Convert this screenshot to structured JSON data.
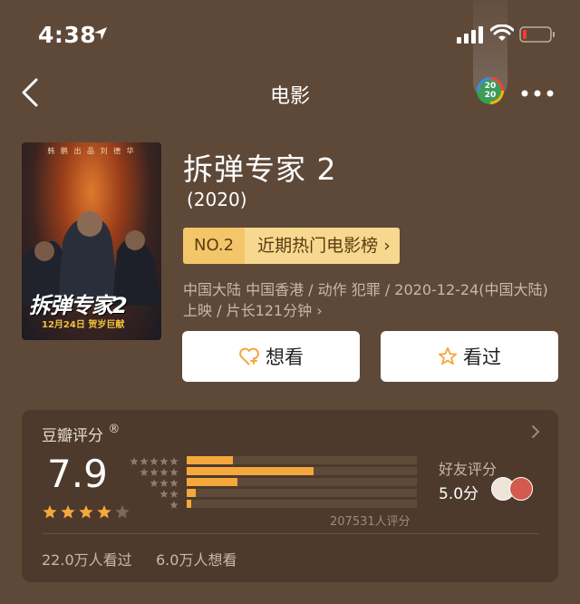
{
  "status_bar": {
    "time": "4:38"
  },
  "nav": {
    "title": "电影",
    "badge_top": "20",
    "badge_bottom": "20"
  },
  "poster": {
    "top_text": "韩 鹏 出 品   刘 德 华",
    "title_text": "拆弹专家2",
    "date_text": "12月24日 贺岁巨献"
  },
  "movie": {
    "title": "拆弹专家 2",
    "year": "(2020)",
    "rank_no": "NO.2",
    "rank_label": "近期热门电影榜",
    "meta": "中国大陆 中国香港 / 动作 犯罪 / 2020-12-24(中国大陆) 上映 / 片长121分钟"
  },
  "buttons": {
    "want": "想看",
    "seen": "看过"
  },
  "rating": {
    "heading": "豆瓣评分",
    "score": "7.9",
    "stars_filled": 4,
    "stars_total": 5,
    "distribution": [
      0.2,
      0.55,
      0.22,
      0.04,
      0.02
    ],
    "count_text": "207531人评分",
    "friend_label": "好友评分",
    "friend_score": "5.0分",
    "seen_text": "22.0万人看过",
    "want_text": "6.0万人想看"
  },
  "colors": {
    "background": "#5e4939",
    "card": "#4d3a2c",
    "accent_star": "#f5a83c",
    "rank_badge": "#f4c66a"
  }
}
